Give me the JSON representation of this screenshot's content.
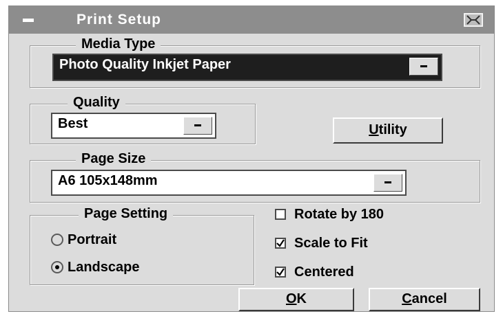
{
  "window": {
    "title": "Print Setup"
  },
  "media_type": {
    "legend": "Media Type",
    "selected": "Photo Quality Inkjet Paper"
  },
  "quality": {
    "legend": "Quality",
    "selected": "Best"
  },
  "utility_button": {
    "prefix": "U",
    "rest": "tility"
  },
  "page_size": {
    "legend": "Page Size",
    "selected": "A6 105x148mm"
  },
  "page_setting": {
    "legend": "Page Setting",
    "portrait_label": "Portrait",
    "landscape_label": "Landscape",
    "selected": "Landscape"
  },
  "options": {
    "rotate_label": "Rotate by 180",
    "rotate_checked": false,
    "scale_label": "Scale to Fit",
    "scale_checked": true,
    "centered_label": "Centered",
    "centered_checked": true
  },
  "buttons": {
    "ok_prefix": "O",
    "ok_rest": "K",
    "cancel_prefix": "C",
    "cancel_rest": "ancel"
  }
}
